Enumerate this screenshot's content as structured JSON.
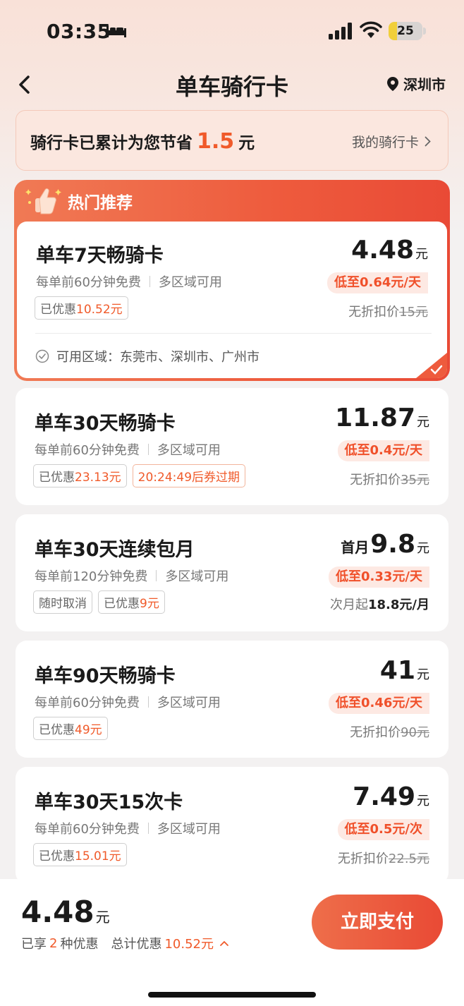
{
  "status_bar": {
    "time": "03:35",
    "battery": "25",
    "battery_level": 0.25
  },
  "nav": {
    "title": "单车骑行卡",
    "city": "深圳市"
  },
  "savings": {
    "prefix": "骑行卡已累计为您节省",
    "amount": "1.5",
    "unit": "元",
    "link": "我的骑行卡"
  },
  "hot": {
    "title": "热门推荐"
  },
  "cards": [
    {
      "title": "单车7天畅骑卡",
      "sub1": "每单前60分钟免费",
      "sub2": "多区域可用",
      "tag1_label": "已优惠",
      "tag1_value": "10.52元",
      "price": "4.48",
      "price_unit": "元",
      "per_day": "低至0.64元/天",
      "orig_label": "无折扣价",
      "orig_value": "15元",
      "area": "可用区域：东莞市、深圳市、广州市"
    },
    {
      "title": "单车30天畅骑卡",
      "sub1": "每单前60分钟免费",
      "sub2": "多区域可用",
      "tag1_label": "已优惠",
      "tag1_value": "23.13元",
      "tag2": "20:24:49后券过期",
      "price": "11.87",
      "price_unit": "元",
      "per_day": "低至0.4元/天",
      "orig_label": "无折扣价",
      "orig_value": "35元"
    },
    {
      "title": "单车30天连续包月",
      "sub1": "每单前120分钟免费",
      "sub2": "多区域可用",
      "tag0": "随时取消",
      "tag1_label": "已优惠",
      "tag1_value": "9元",
      "price_prefix": "首月",
      "price": "9.8",
      "price_unit": "元",
      "per_day": "低至0.33元/天",
      "orig_label": "次月起",
      "orig_value": "18.8元/月"
    },
    {
      "title": "单车90天畅骑卡",
      "sub1": "每单前60分钟免费",
      "sub2": "多区域可用",
      "tag1_label": "已优惠",
      "tag1_value": "49元",
      "price": "41",
      "price_unit": "元",
      "per_day": "低至0.46元/天",
      "orig_label": "无折扣价",
      "orig_value": "90元"
    },
    {
      "title": "单车30天15次卡",
      "sub1": "每单前60分钟免费",
      "sub2": "多区域可用",
      "tag1_label": "已优惠",
      "tag1_value": "15.01元",
      "price": "7.49",
      "price_unit": "元",
      "per_day": "低至0.5元/次",
      "orig_label": "无折扣价",
      "orig_value": "22.5元"
    }
  ],
  "bottom": {
    "price": "4.48",
    "unit": "元",
    "info_prefix": "已享",
    "info_count": "2",
    "info_mid": "种优惠",
    "info_total_label": "总计优惠",
    "info_total": "10.52元",
    "pay": "立即支付"
  },
  "colors": {
    "accent": "#f05a2a",
    "hot_header": "#ee5b3d",
    "pay_button": "#e94a35"
  }
}
